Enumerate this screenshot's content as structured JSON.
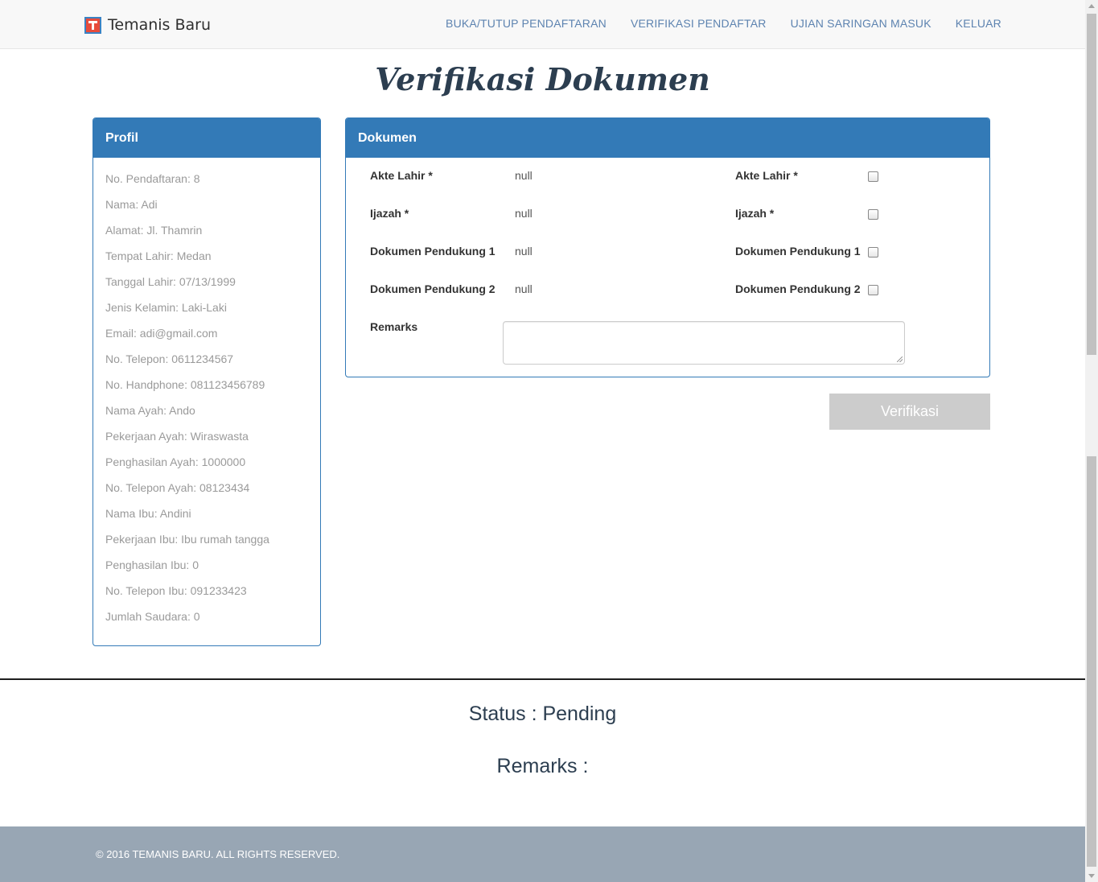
{
  "navbar": {
    "brand": "Temanis Baru",
    "links": [
      "BUKA/TUTUP PENDAFTARAN",
      "VERIFIKASI PENDAFTAR",
      "UJIAN SARINGAN MASUK",
      "KELUAR"
    ]
  },
  "page_title": "Verifikasi Dokumen",
  "profil": {
    "heading": "Profil",
    "items": [
      "No. Pendaftaran: 8",
      "Nama: Adi",
      "Alamat: Jl. Thamrin",
      "Tempat Lahir: Medan",
      "Tanggal Lahir: 07/13/1999",
      "Jenis Kelamin: Laki-Laki",
      "Email: adi@gmail.com",
      "No. Telepon: 0611234567",
      "No. Handphone: 081123456789",
      "Nama Ayah: Ando",
      "Pekerjaan Ayah: Wiraswasta",
      "Penghasilan Ayah: 1000000",
      "No. Telepon Ayah: 08123434",
      "Nama Ibu: Andini",
      "Pekerjaan Ibu: Ibu rumah tangga",
      "Penghasilan Ibu: 0",
      "No. Telepon Ibu: 091233423",
      "Jumlah Saudara: 0"
    ]
  },
  "dokumen": {
    "heading": "Dokumen",
    "rows": [
      {
        "label": "Akte Lahir *",
        "value": "null",
        "check_label": "Akte Lahir *",
        "checked": false
      },
      {
        "label": "Ijazah *",
        "value": "null",
        "check_label": "Ijazah *",
        "checked": false
      },
      {
        "label": "Dokumen Pendukung 1",
        "value": "null",
        "check_label": "Dokumen Pendukung 1",
        "checked": false
      },
      {
        "label": "Dokumen Pendukung 2",
        "value": "null",
        "check_label": "Dokumen Pendukung 2",
        "checked": false
      }
    ],
    "remarks_label": "Remarks",
    "remarks_value": ""
  },
  "verify_button": "Verifikasi",
  "status_text": "Status : Pending",
  "remarks_text": "Remarks :",
  "footer_text": "© 2016 TEMANIS BARU. ALL RIGHTS RESERVED."
}
